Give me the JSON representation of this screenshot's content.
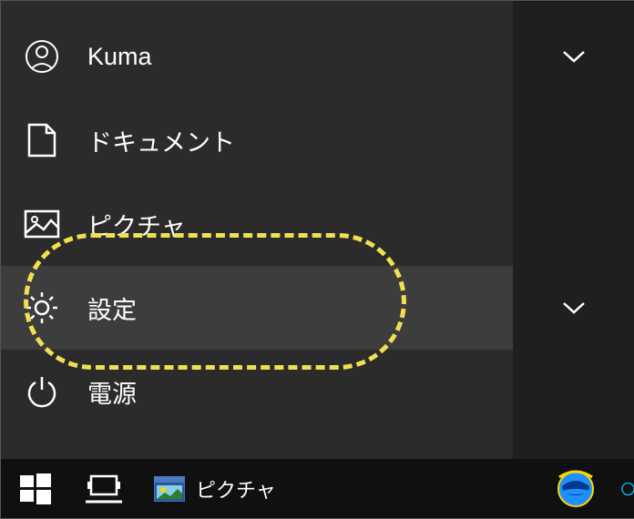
{
  "menu": {
    "user": {
      "label": "Kuma"
    },
    "documents": {
      "label": "ドキュメント"
    },
    "pictures": {
      "label": "ピクチャ"
    },
    "settings": {
      "label": "設定"
    },
    "power": {
      "label": "電源"
    }
  },
  "taskbar": {
    "app_label": "ピクチャ"
  }
}
